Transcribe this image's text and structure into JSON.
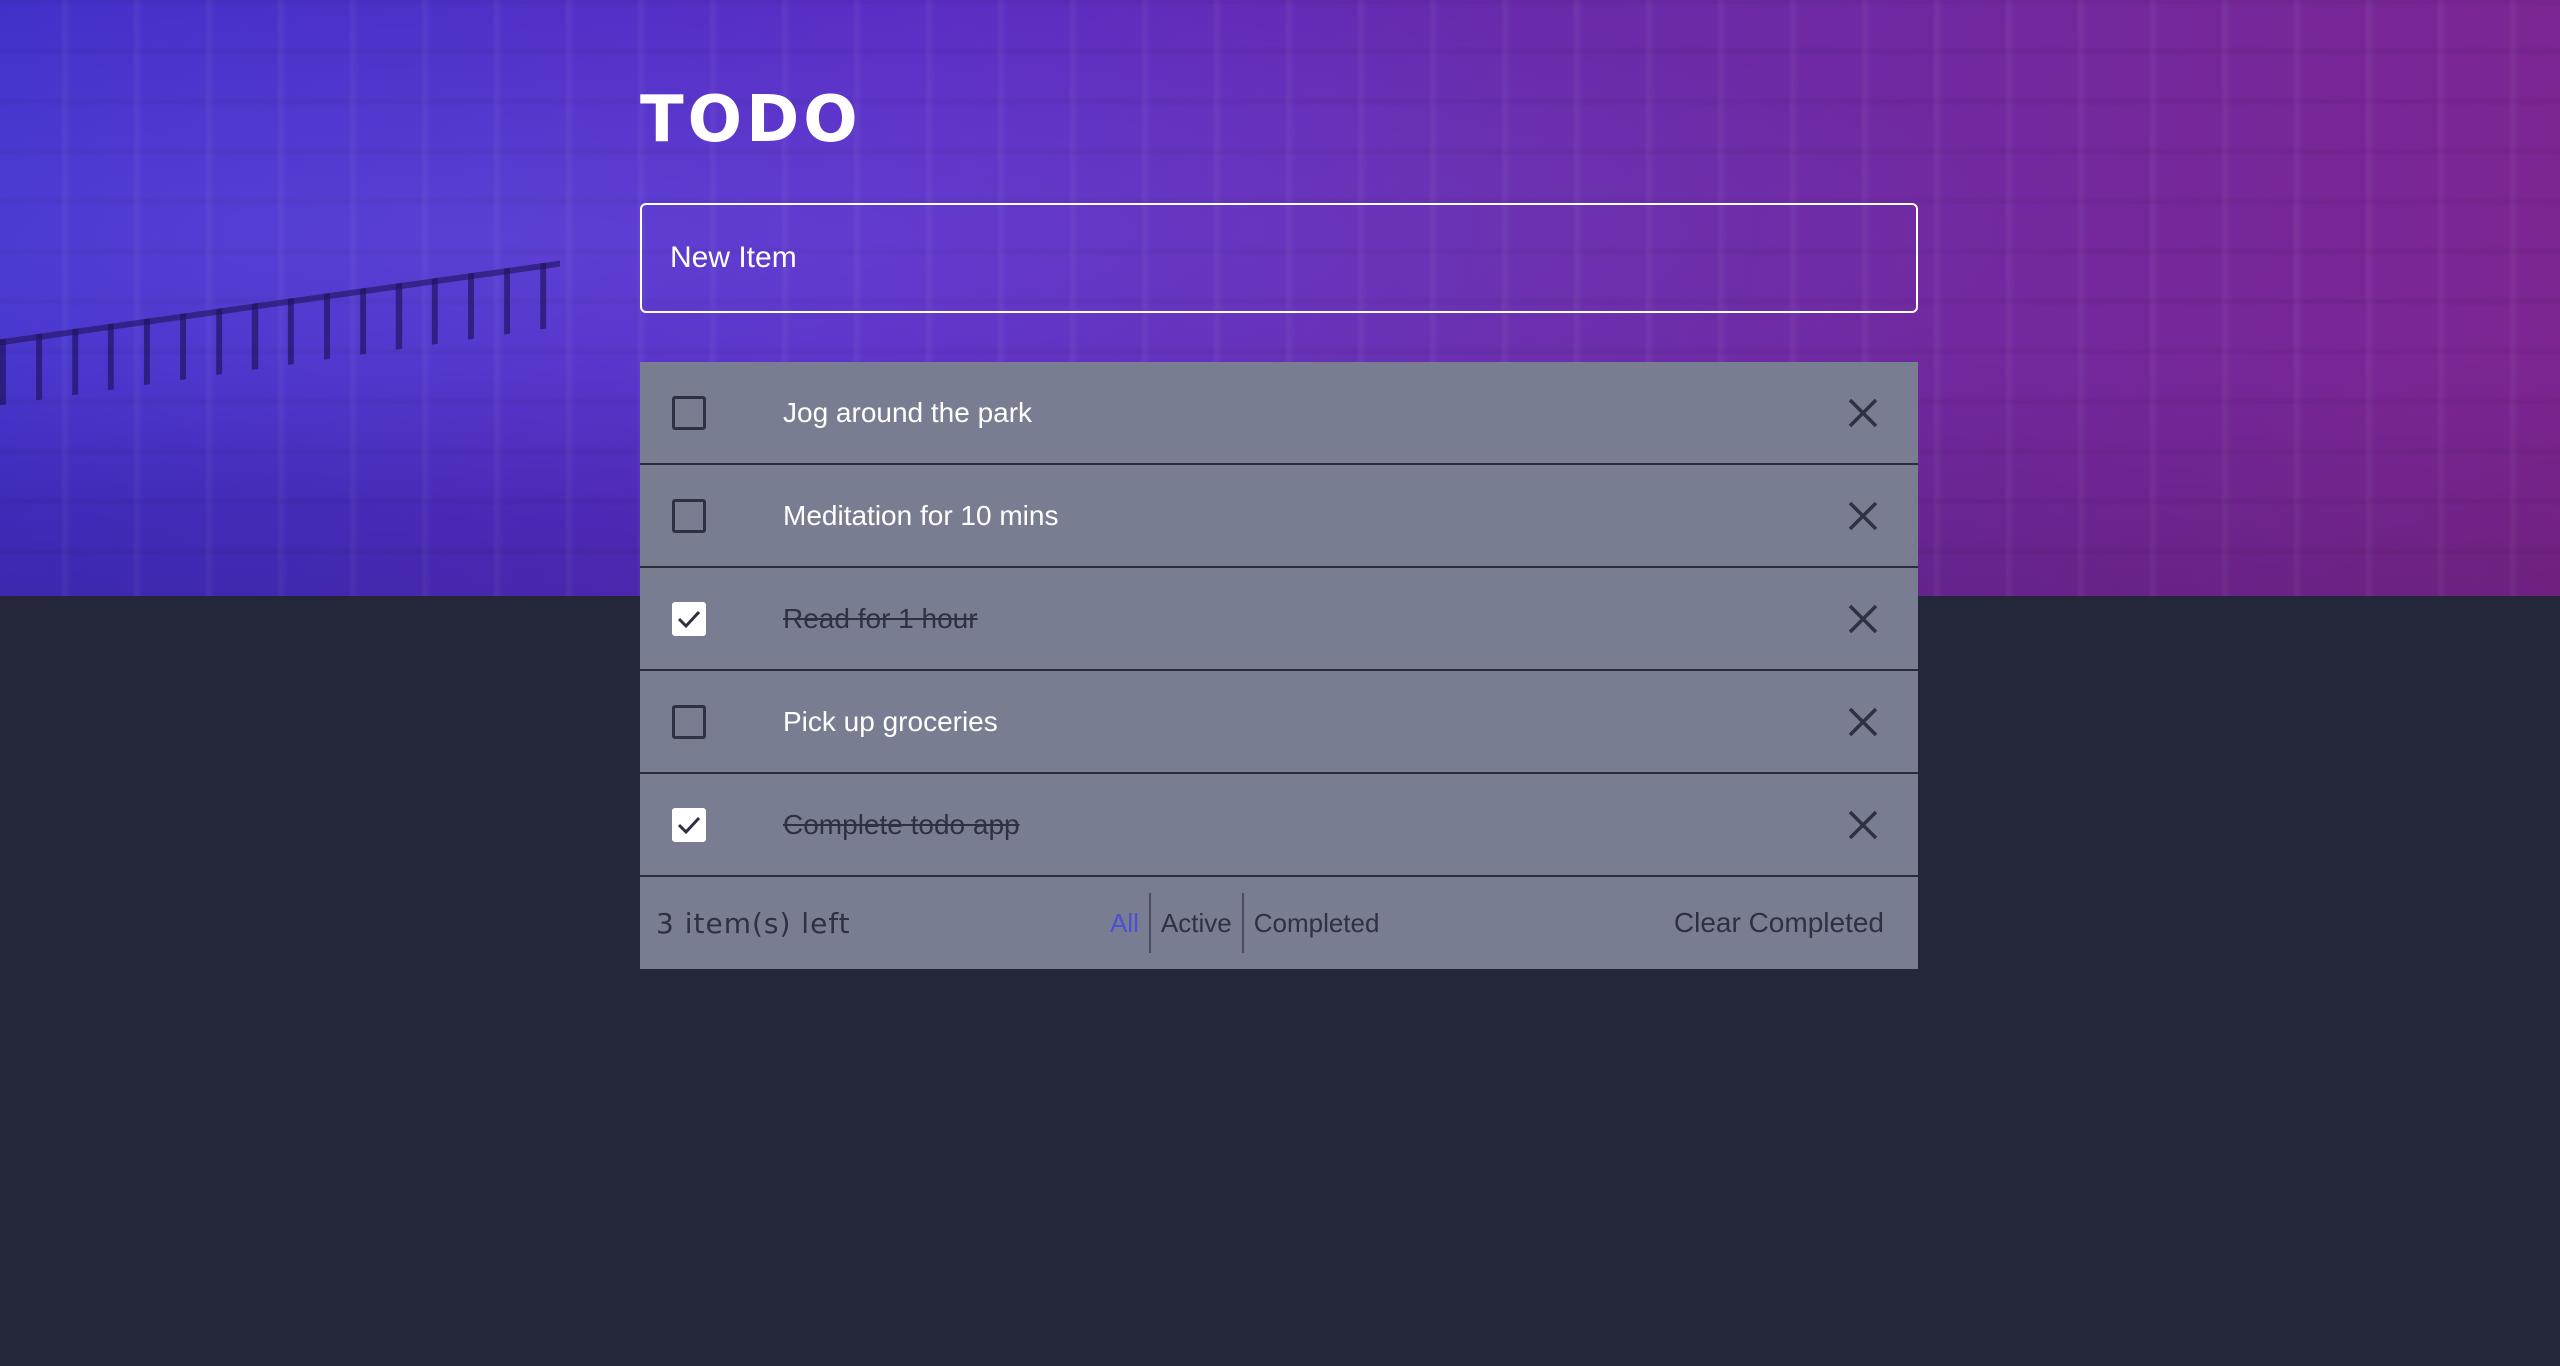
{
  "app": {
    "title": "TODO",
    "colors": {
      "hero_start": "#3f2fc8",
      "hero_end": "#7d2590",
      "background": "#24273a",
      "card": "#797d91",
      "active_filter": "#4a4fd6"
    }
  },
  "new_item": {
    "placeholder": "New Item"
  },
  "todos": [
    {
      "label": "Jog around the park",
      "completed": false
    },
    {
      "label": "Meditation for 10 mins",
      "completed": false
    },
    {
      "label": "Read for 1 hour",
      "completed": true
    },
    {
      "label": "Pick up groceries",
      "completed": false
    },
    {
      "label": "Complete todo app",
      "completed": true
    }
  ],
  "footer": {
    "items_left": "3 item(s) left",
    "filters": [
      "All",
      "Active",
      "Completed"
    ],
    "active_filter": "All",
    "clear_label": "Clear Completed"
  },
  "icons": {
    "checkbox": "checkbox-icon",
    "checkmark": "checkmark-icon",
    "delete": "close-icon"
  }
}
